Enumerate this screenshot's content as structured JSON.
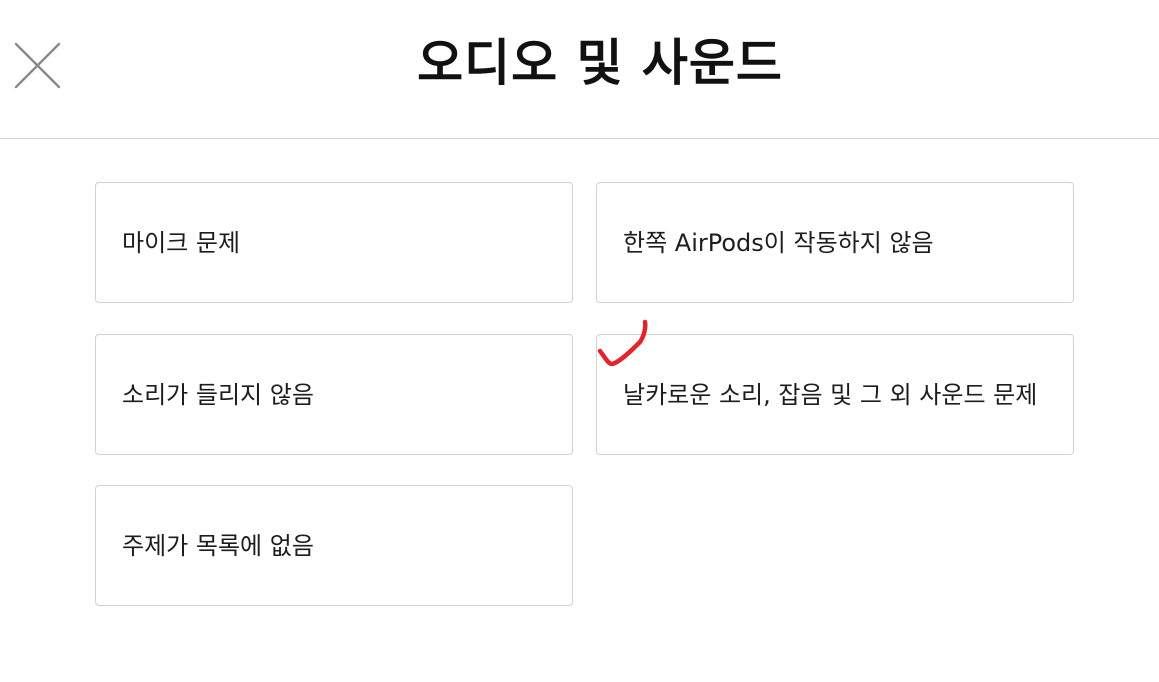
{
  "header": {
    "title": "오디오 및 사운드",
    "close_icon": "close-icon"
  },
  "topics": [
    {
      "label": "마이크 문제"
    },
    {
      "label": "한쪽 AirPods이 작동하지 않음"
    },
    {
      "label": "소리가 들리지 않음"
    },
    {
      "label": "날카로운 소리, 잡음 및 그 외 사운드 문제"
    },
    {
      "label": "주제가 목록에 없음"
    }
  ],
  "annotation": {
    "icon": "checkmark-annotation-icon",
    "color": "#e0262c"
  },
  "colors": {
    "border": "#d2d2d7",
    "text": "#1d1d1f",
    "close_icon": "#8a8a8a"
  }
}
